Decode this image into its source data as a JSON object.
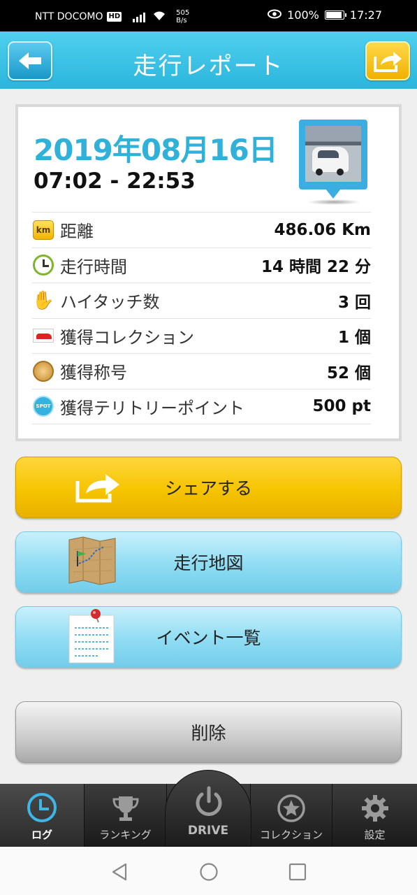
{
  "status_bar": {
    "carrier": "NTT DOCOMO",
    "hd_badge": "HD",
    "net_speed_value": "505",
    "net_speed_unit": "B/s",
    "battery": "100%",
    "time": "17:27"
  },
  "header": {
    "title": "走行レポート"
  },
  "report": {
    "date": "2019年08月16日",
    "time_range": "07:02 - 22:53",
    "rows": [
      {
        "icon": "km",
        "label": "距離",
        "value": "486.06 Km"
      },
      {
        "icon": "clock",
        "label": "走行時間",
        "value": "14 時間 22 分"
      },
      {
        "icon": "hi-touch-hand",
        "label": "ハイタッチ数",
        "value": "3 回"
      },
      {
        "icon": "car",
        "label": "獲得コレクション",
        "value": "1 個"
      },
      {
        "icon": "medal",
        "label": "獲得称号",
        "value": "52 個"
      },
      {
        "icon": "spot",
        "label": "獲得テリトリーポイント",
        "value": "500 pt"
      }
    ],
    "km_icon_text": "km",
    "spot_icon_text": "SPOT"
  },
  "actions": {
    "share": "シェアする",
    "map": "走行地図",
    "events": "イベント一覧",
    "delete": "削除"
  },
  "tabs": {
    "log": "ログ",
    "ranking": "ランキング",
    "drive": "DRIVE",
    "collection": "コレクション",
    "settings": "設定"
  },
  "colors": {
    "header": "#2bb5dd",
    "date": "#2fb1d9",
    "share_button": "#f6c400",
    "map_button": "#8fdcf3",
    "delete_button": "#cfcfcf"
  }
}
